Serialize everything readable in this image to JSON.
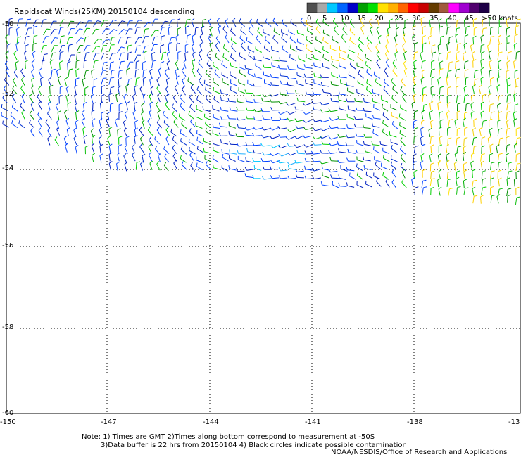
{
  "title": "Rapidscat Winds(25KM) 20150104 descending",
  "legend": {
    "labels": [
      "0",
      "5",
      "10",
      "15",
      "20",
      "25",
      "30",
      "35",
      "40",
      "45",
      ">50 knots"
    ],
    "colors": [
      "#505050",
      "#a8a8a8",
      "#00c8ff",
      "#0064ff",
      "#0000c8",
      "#00a000",
      "#00e000",
      "#ffe000",
      "#ffb000",
      "#ff6400",
      "#ff0000",
      "#c80000",
      "#643c00",
      "#a05a3c",
      "#ff00ff",
      "#a000d0",
      "#50006e",
      "#1e0046"
    ]
  },
  "axes": {
    "lat_labels": [
      "-50",
      "-52",
      "-54",
      "-56",
      "-58",
      "-60"
    ],
    "lon_labels": [
      "-150",
      "-147",
      "-144",
      "-141",
      "-138",
      "-13"
    ]
  },
  "notes": {
    "line1": "Note: 1) Times are GMT 2)Times along bottom correspond to measurement at -50S",
    "line2": "3)Data buffer is 22 hrs from 20150104 4) Black circles indicate possible contamination",
    "line3": "NOAA/NESDIS/Office of Research and Applications"
  }
}
